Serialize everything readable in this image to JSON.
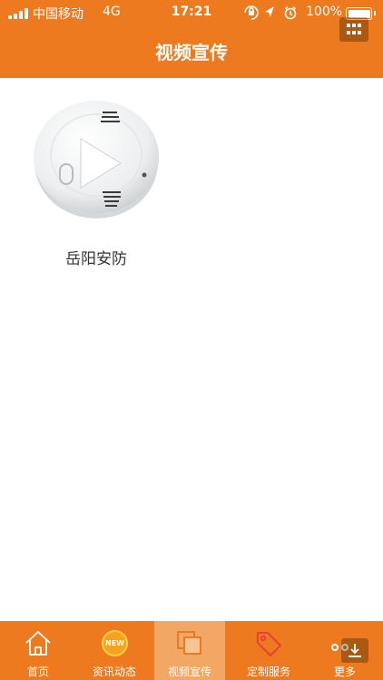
{
  "status_bar": {
    "carrier": "中国移动",
    "network": "4G",
    "time": "17:21",
    "battery": "100%"
  },
  "header": {
    "title": "视频宣传"
  },
  "videos": [
    {
      "title": "岳阳安防",
      "thumbnail": "smoke-detector-image"
    }
  ],
  "tabbar": {
    "items": [
      {
        "label": "首页",
        "icon": "home-icon"
      },
      {
        "label": "资讯动态",
        "icon": "new-badge-icon",
        "badge": "NEW"
      },
      {
        "label": "视频宣传",
        "icon": "video-frames-icon",
        "active": true
      },
      {
        "label": "定制服务",
        "icon": "tag-icon"
      },
      {
        "label": "更多",
        "icon": "more-icon"
      }
    ]
  },
  "colors": {
    "brand": "#ed7a1e",
    "active_tab": "#f2a765",
    "text": "#333333"
  }
}
